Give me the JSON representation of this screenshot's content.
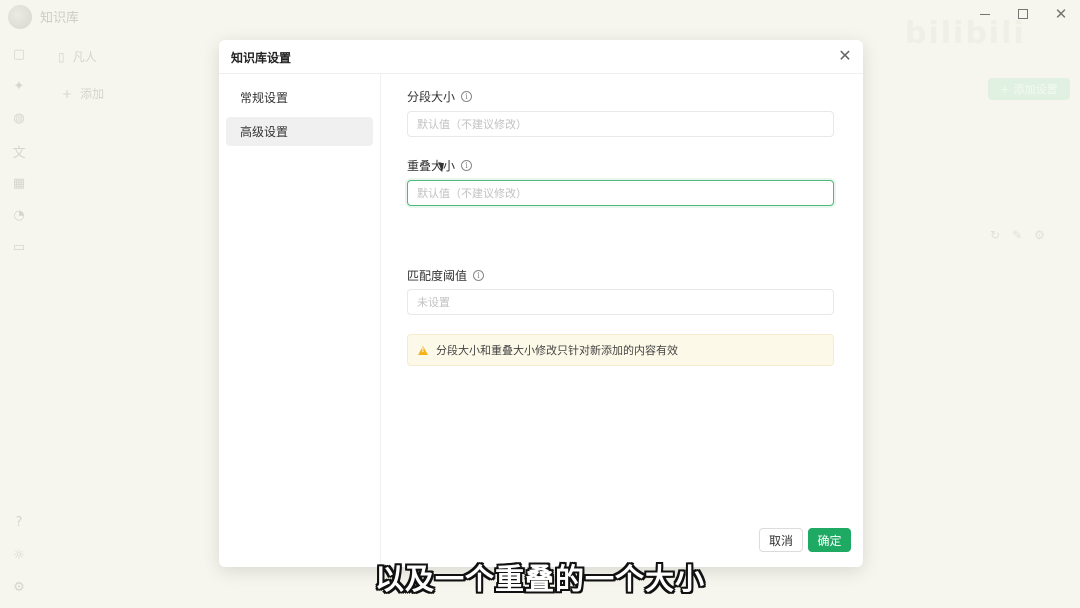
{
  "app": {
    "title": "知识库",
    "kb_item": "凡人",
    "add_label": "添加",
    "add_setting_label": "添加设置",
    "watermark": "bilibili"
  },
  "window_controls": {
    "minimize_icon": "minimize-icon",
    "maximize_icon": "maximize-icon",
    "close_icon": "close-icon"
  },
  "rail": {
    "icons": [
      "chat-icon",
      "sparkle-icon",
      "palette-icon",
      "translate-icon",
      "apps-icon",
      "history-icon",
      "folder-icon",
      "help-icon",
      "theme-icon",
      "settings-icon"
    ]
  },
  "dialog": {
    "title": "知识库设置",
    "close_glyph": "✕",
    "nav": [
      {
        "label": "常规设置",
        "active": false
      },
      {
        "label": "高级设置",
        "active": true
      }
    ],
    "fields": [
      {
        "label": "分段大小",
        "placeholder": "默认值（不建议修改）",
        "value": "",
        "focused": false
      },
      {
        "label": "重叠大小",
        "placeholder": "默认值（不建议修改）",
        "value": "",
        "focused": true
      },
      {
        "label": "匹配度阈值",
        "placeholder": "未设置",
        "value": "",
        "focused": false
      }
    ],
    "notice": "分段大小和重叠大小修改只针对新添加的内容有效",
    "cancel_label": "取消",
    "ok_label": "确定"
  },
  "subtitle": "以及一个重叠的一个大小",
  "colors": {
    "accent": "#1faa63",
    "focus_border": "#4cb87a",
    "notice_bg": "#fdf9e8",
    "warning": "#f3b41b"
  }
}
